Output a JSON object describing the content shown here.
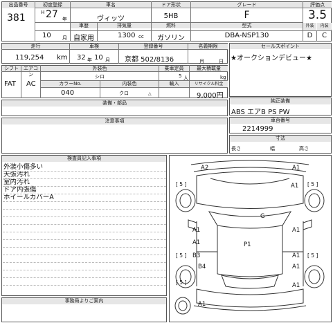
{
  "header": {
    "lot_label": "出品番号",
    "lot": "381",
    "year_label": "初度登録",
    "era": "H",
    "year_num": "27",
    "year_suffix": "年",
    "month": "10",
    "month_suffix": "月",
    "model_label": "車名",
    "model": "ヴィッツ",
    "usage_label": "車歴",
    "usage": "自家用",
    "door_label": "ドア形状",
    "door": "5HB",
    "cc_label": "排気量",
    "cc": "1300",
    "cc_unit": "cc",
    "fuel_label": "燃料",
    "fuel": "ガソリン",
    "grade_label": "グレード",
    "grade": "F",
    "type_label": "型式",
    "type": "DBA-NSP130",
    "score_label": "評価点",
    "score": "3.5",
    "ext_label": "外装",
    "ext": "D",
    "int_label": "内装",
    "int": "C"
  },
  "row2": {
    "mileage_label": "走行",
    "mileage": "119,254",
    "mileage_unit": "km",
    "inspect_label": "車検",
    "inspect_year": "32",
    "inspect_year_suffix": "年",
    "inspect_month": "10",
    "inspect_month_suffix": "月",
    "plate_label": "登録番号",
    "plate": "京都 502/8136",
    "recycle_label": "名義期限",
    "recycle_month": "月",
    "recycle_day": "日",
    "sales_label": "セールスポイント",
    "sales": "★オークションデビュー★"
  },
  "row3": {
    "shift_label": "シフト",
    "shift": "FAT",
    "ac_label": "エアコン",
    "ac": "AC",
    "color_label": "外装色",
    "color": "シロ",
    "capacity_label": "乗車定員",
    "capacity": "5",
    "capacity_unit": "人",
    "load_label": "最大積載量",
    "load_unit": "kg",
    "colorno_label": "カラーNo.",
    "colorno": "040",
    "intcolor_label": "内装色",
    "intcolor": "クロ",
    "import_label": "輸入",
    "import_mark": "△",
    "recycle_fee_label": "リサイクル料金",
    "recycle_fee": "9,000円"
  },
  "equipment": {
    "label": "純正装備",
    "value": "ABS エアB PS PW"
  },
  "parts_label": "装備・部品",
  "notes_label": "注意事項",
  "chassis": {
    "label": "車台番号",
    "value": "2214999"
  },
  "size": {
    "label": "寸法",
    "length": "長さ",
    "width": "幅",
    "height": "高さ"
  },
  "inspector": {
    "label": "検査員記入事項",
    "lines": [
      "外装小傷多い",
      "天張汚れ",
      "室内汚れ",
      "ドア内張傷",
      "ホイールカバーA"
    ]
  },
  "office_label": "事務局よりご案内",
  "diagram": {
    "marks": [
      "A2",
      "A1",
      "A1",
      "A1",
      "G",
      "A1",
      "A1",
      "P1",
      "B3",
      "A1",
      "B4",
      "A1",
      "A1",
      "A1"
    ],
    "brackets": [
      "[ 5 ]",
      "[ 5 ]",
      "[ 5 ]",
      "[ 5 ]",
      "[ 5 ]"
    ]
  }
}
